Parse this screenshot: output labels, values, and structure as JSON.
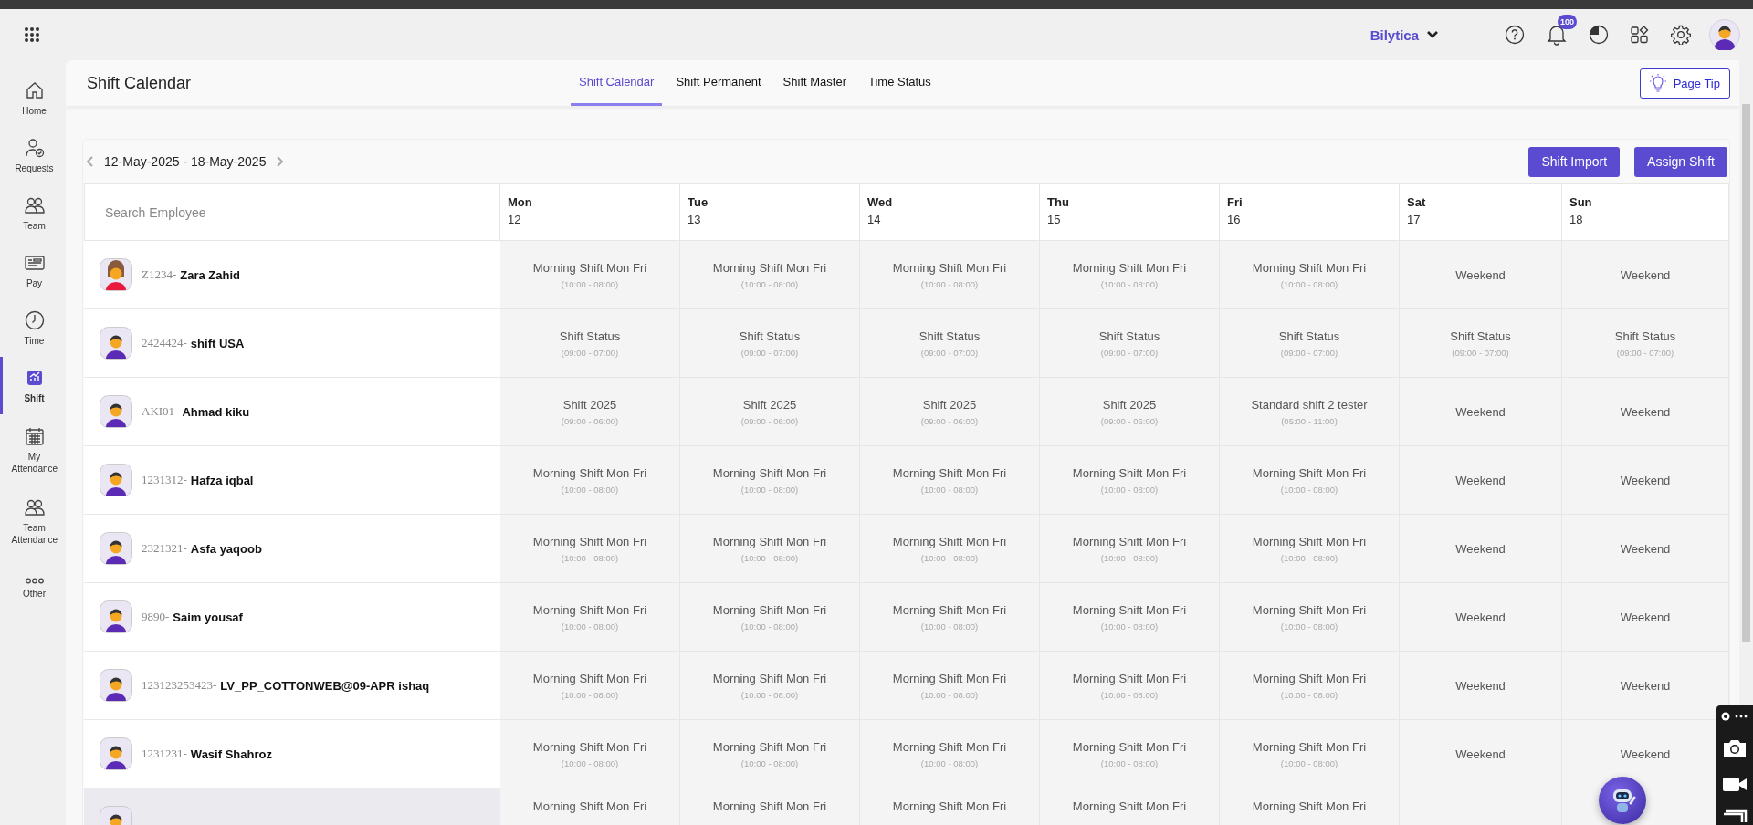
{
  "top_bar": {
    "brand": "Bilytica",
    "notification_count": "100"
  },
  "sidebar": {
    "items": [
      {
        "label": "Home",
        "selected": false
      },
      {
        "label": "Requests",
        "selected": false
      },
      {
        "label": "Team",
        "selected": false
      },
      {
        "label": "Pay",
        "selected": false
      },
      {
        "label": "Time",
        "selected": false
      },
      {
        "label": "Shift",
        "selected": true
      },
      {
        "label": "My Attendance",
        "selected": false
      },
      {
        "label": "Team Attendance",
        "selected": false
      },
      {
        "label": "Other",
        "selected": false
      }
    ]
  },
  "page": {
    "title": "Shift Calendar",
    "page_tip": "Page Tip"
  },
  "tabs": [
    {
      "label": "Shift Calendar",
      "selected": true
    },
    {
      "label": "Shift Permanent",
      "selected": false
    },
    {
      "label": "Shift Master",
      "selected": false
    },
    {
      "label": "Time Status",
      "selected": false
    }
  ],
  "toolbar": {
    "date_range": "12-May-2025 - 18-May-2025",
    "buttons": [
      "Shift Import",
      "Assign Shift"
    ]
  },
  "table": {
    "search": {
      "placeholder": "Search Employee"
    },
    "days": [
      {
        "day": "Mon",
        "date": "12"
      },
      {
        "day": "Tue",
        "date": "13"
      },
      {
        "day": "Wed",
        "date": "14"
      },
      {
        "day": "Thu",
        "date": "15"
      },
      {
        "day": "Fri",
        "date": "16"
      },
      {
        "day": "Sat",
        "date": "17"
      },
      {
        "day": "Sun",
        "date": "18"
      }
    ],
    "rows": [
      {
        "code": "Z1234-",
        "name": "Zara Zahid",
        "kind": "female",
        "selected": false,
        "cells": [
          {
            "title": "Morning Shift Mon Fri",
            "time": "(10:00 - 08:00)"
          },
          {
            "title": "Morning Shift Mon Fri",
            "time": "(10:00 - 08:00)"
          },
          {
            "title": "Morning Shift Mon Fri",
            "time": "(10:00 - 08:00)"
          },
          {
            "title": "Morning Shift Mon Fri",
            "time": "(10:00 - 08:00)"
          },
          {
            "title": "Morning Shift Mon Fri",
            "time": "(10:00 - 08:00)"
          },
          {
            "title": "Weekend"
          },
          {
            "title": "Weekend"
          }
        ]
      },
      {
        "code": "2424424-",
        "name": "shift USA",
        "kind": "male",
        "selected": false,
        "cells": [
          {
            "title": "Shift Status",
            "time": "(09:00 - 07:00)"
          },
          {
            "title": "Shift Status",
            "time": "(09:00 - 07:00)"
          },
          {
            "title": "Shift Status",
            "time": "(09:00 - 07:00)"
          },
          {
            "title": "Shift Status",
            "time": "(09:00 - 07:00)"
          },
          {
            "title": "Shift Status",
            "time": "(09:00 - 07:00)"
          },
          {
            "title": "Shift Status",
            "time": "(09:00 - 07:00)"
          },
          {
            "title": "Shift Status",
            "time": "(09:00 - 07:00)"
          }
        ]
      },
      {
        "code": "AKI01-",
        "name": "Ahmad kiku",
        "kind": "male",
        "selected": false,
        "cells": [
          {
            "title": "Shift 2025",
            "time": "(09:00 - 06:00)"
          },
          {
            "title": "Shift 2025",
            "time": "(09:00 - 06:00)"
          },
          {
            "title": "Shift 2025",
            "time": "(09:00 - 06:00)"
          },
          {
            "title": "Shift 2025",
            "time": "(09:00 - 06:00)"
          },
          {
            "title": "Standard shift 2 tester",
            "time": "(05:00 - 11:00)"
          },
          {
            "title": "Weekend"
          },
          {
            "title": "Weekend"
          }
        ]
      },
      {
        "code": "1231312-",
        "name": "Hafza iqbal",
        "kind": "male",
        "selected": false,
        "cells": [
          {
            "title": "Morning Shift Mon Fri",
            "time": "(10:00 - 08:00)"
          },
          {
            "title": "Morning Shift Mon Fri",
            "time": "(10:00 - 08:00)"
          },
          {
            "title": "Morning Shift Mon Fri",
            "time": "(10:00 - 08:00)"
          },
          {
            "title": "Morning Shift Mon Fri",
            "time": "(10:00 - 08:00)"
          },
          {
            "title": "Morning Shift Mon Fri",
            "time": "(10:00 - 08:00)"
          },
          {
            "title": "Weekend"
          },
          {
            "title": "Weekend"
          }
        ]
      },
      {
        "code": "2321321-",
        "name": "Asfa yaqoob",
        "kind": "male",
        "selected": false,
        "cells": [
          {
            "title": "Morning Shift Mon Fri",
            "time": "(10:00 - 08:00)"
          },
          {
            "title": "Morning Shift Mon Fri",
            "time": "(10:00 - 08:00)"
          },
          {
            "title": "Morning Shift Mon Fri",
            "time": "(10:00 - 08:00)"
          },
          {
            "title": "Morning Shift Mon Fri",
            "time": "(10:00 - 08:00)"
          },
          {
            "title": "Morning Shift Mon Fri",
            "time": "(10:00 - 08:00)"
          },
          {
            "title": "Weekend"
          },
          {
            "title": "Weekend"
          }
        ]
      },
      {
        "code": "9890-",
        "name": "Saim yousaf",
        "kind": "male",
        "selected": false,
        "cells": [
          {
            "title": "Morning Shift Mon Fri",
            "time": "(10:00 - 08:00)"
          },
          {
            "title": "Morning Shift Mon Fri",
            "time": "(10:00 - 08:00)"
          },
          {
            "title": "Morning Shift Mon Fri",
            "time": "(10:00 - 08:00)"
          },
          {
            "title": "Morning Shift Mon Fri",
            "time": "(10:00 - 08:00)"
          },
          {
            "title": "Morning Shift Mon Fri",
            "time": "(10:00 - 08:00)"
          },
          {
            "title": "Weekend"
          },
          {
            "title": "Weekend"
          }
        ]
      },
      {
        "code": "123123253423-",
        "name": "LV_PP_COTTONWEB@09-APR ishaq",
        "kind": "male",
        "selected": false,
        "cells": [
          {
            "title": "Morning Shift Mon Fri",
            "time": "(10:00 - 08:00)"
          },
          {
            "title": "Morning Shift Mon Fri",
            "time": "(10:00 - 08:00)"
          },
          {
            "title": "Morning Shift Mon Fri",
            "time": "(10:00 - 08:00)"
          },
          {
            "title": "Morning Shift Mon Fri",
            "time": "(10:00 - 08:00)"
          },
          {
            "title": "Morning Shift Mon Fri",
            "time": "(10:00 - 08:00)"
          },
          {
            "title": "Weekend"
          },
          {
            "title": "Weekend"
          }
        ]
      },
      {
        "code": "1231231-",
        "name": "Wasif Shahroz",
        "kind": "male",
        "selected": false,
        "cells": [
          {
            "title": "Morning Shift Mon Fri",
            "time": "(10:00 - 08:00)"
          },
          {
            "title": "Morning Shift Mon Fri",
            "time": "(10:00 - 08:00)"
          },
          {
            "title": "Morning Shift Mon Fri",
            "time": "(10:00 - 08:00)"
          },
          {
            "title": "Morning Shift Mon Fri",
            "time": "(10:00 - 08:00)"
          },
          {
            "title": "Morning Shift Mon Fri",
            "time": "(10:00 - 08:00)"
          },
          {
            "title": "Weekend"
          },
          {
            "title": "Weekend"
          }
        ]
      },
      {
        "kind": "male",
        "selected": true,
        "cells": [
          {
            "title": "Morning Shift Mon Fri"
          },
          {
            "title": "Morning Shift Mon Fri"
          },
          {
            "title": "Morning Shift Mon Fri"
          },
          {
            "title": "Morning Shift Mon Fri"
          },
          {
            "title": "Morning Shift Mon Fri"
          }
        ]
      }
    ]
  }
}
